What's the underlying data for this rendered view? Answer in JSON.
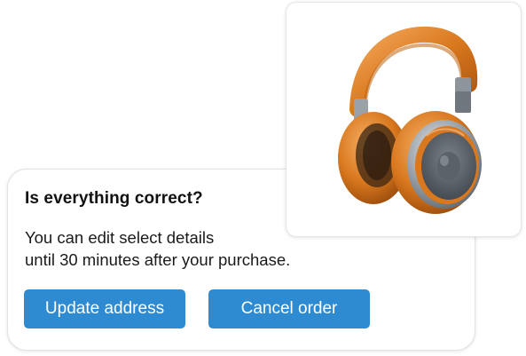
{
  "dialog": {
    "title": "Is everything correct?",
    "body_line1": "You can edit select details",
    "body_line2": "until 30 minutes after your purchase.",
    "update_button_label": "Update address",
    "cancel_button_label": "Cancel order"
  },
  "product": {
    "image_icon": "headphones-icon"
  },
  "colors": {
    "primary_button": "#2e8bd1",
    "button_text": "#ffffff",
    "headphone_orange": "#d9781e",
    "headphone_silver": "#8a9097"
  }
}
